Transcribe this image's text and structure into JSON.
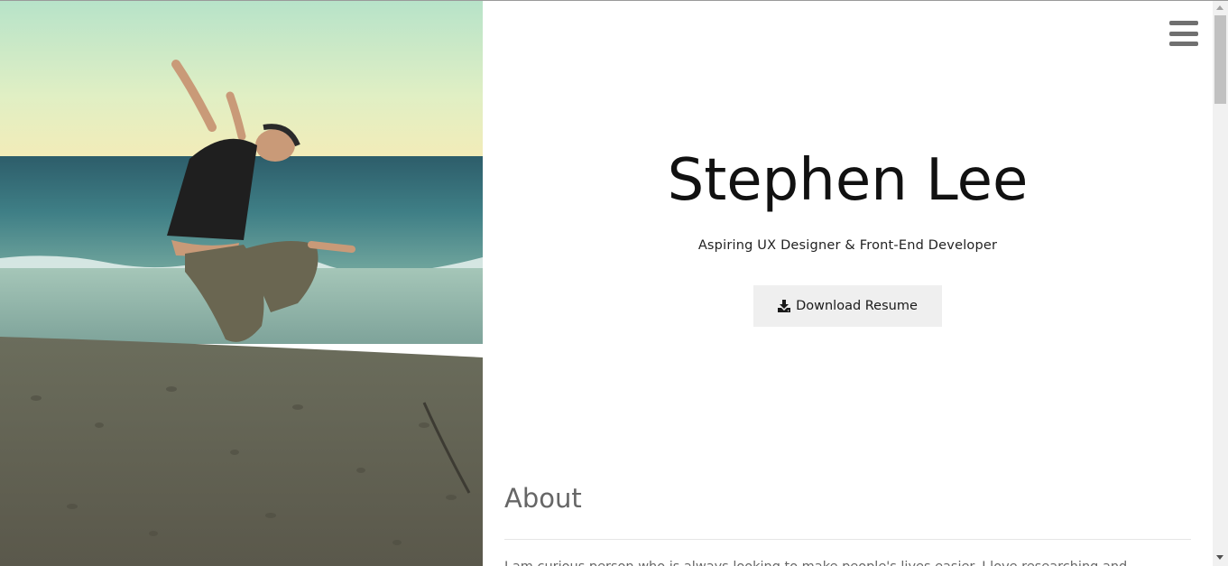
{
  "hero": {
    "name": "Stephen Lee",
    "tagline": "Aspiring UX Designer & Front-End Developer",
    "download_label": "Download Resume",
    "download_icon": "download-icon"
  },
  "nav": {
    "menu_icon": "hamburger-menu-icon"
  },
  "about": {
    "heading": "About",
    "text": "I am curious person who is always looking to make people's lives easier. I love researching and"
  },
  "colors": {
    "button_bg": "#efefef",
    "heading_gray": "#666666",
    "menu_gray": "#707070",
    "name_color": "#111111"
  }
}
